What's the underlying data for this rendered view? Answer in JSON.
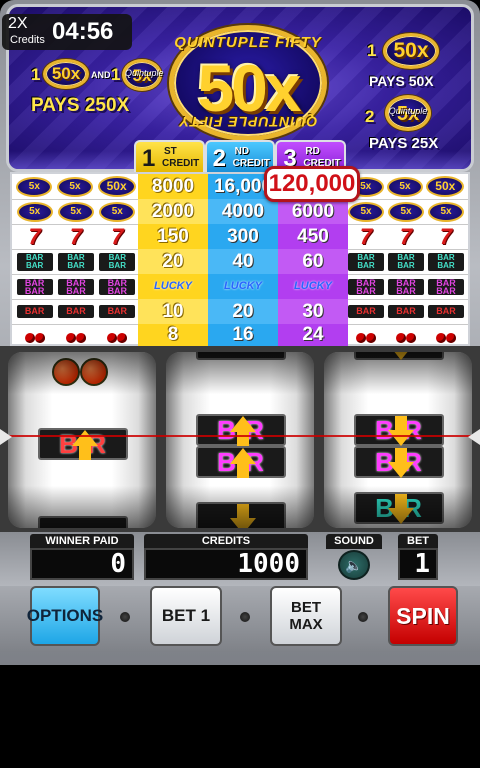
{
  "status": {
    "multiplier": "2X",
    "credits_label": "Credits",
    "time": "04:56"
  },
  "top_panel": {
    "logo_top_arc": "QUINTUPLE FIFTY",
    "logo_bottom_arc": "QUINTUPLE FIFTY",
    "logo_big": "50x",
    "left_prefix_1": "1",
    "left_badge_50x": "50x",
    "left_and": "AND",
    "left_prefix_2": "1",
    "left_badge_5x": "5x",
    "left_badge_caption": "Quintuple",
    "left_pays": "PAYS 250X",
    "right_prefix_1": "1",
    "right_badge_50x": "50x",
    "right_pays_1": "PAYS 50X",
    "right_prefix_2": "2",
    "right_badge_5x": "5x",
    "right_badge_caption": "Quintuple",
    "right_pays_2": "PAYS 25X"
  },
  "paytable_header": [
    {
      "num": "1",
      "sup": "ST",
      "word": "CREDIT"
    },
    {
      "num": "2",
      "sup": "ND",
      "word": "CREDIT"
    },
    {
      "num": "3",
      "sup": "RD",
      "word": "CREDIT"
    }
  ],
  "jackpot": "120,000",
  "paytable": [
    {
      "symbol": "50x-mix",
      "c1": "8000",
      "c2": "16,000",
      "c3": ""
    },
    {
      "symbol": "5x",
      "c1": "2000",
      "c2": "4000",
      "c3": "6000"
    },
    {
      "symbol": "seven",
      "c1": "150",
      "c2": "300",
      "c3": "450"
    },
    {
      "symbol": "triple-bar",
      "c1": "20",
      "c2": "40",
      "c3": "60"
    },
    {
      "symbol": "lucky-wheel",
      "c1": "LUCKY WHEEL",
      "c2": "LUCKY WHEEL",
      "c3": "LUCKY WHEEL"
    },
    {
      "symbol": "single-bar",
      "c1": "10",
      "c2": "20",
      "c3": "30"
    },
    {
      "symbol": "cherry",
      "c1": "8",
      "c2": "16",
      "c3": "24"
    }
  ],
  "symbol_text": {
    "small_50x": "50x",
    "small_5x": "5x",
    "seven": "7",
    "bar": "BAR",
    "bar_short": "B  R"
  },
  "reels": [
    {
      "main_bar": "B  R"
    },
    {
      "main_bar_1": "B  R",
      "main_bar_2": "B  R"
    },
    {
      "main_bar_1": "B  R",
      "main_bar_2": "B  R",
      "lower_bar": "B  R"
    }
  ],
  "displays": {
    "winner_paid_label": "WINNER PAID",
    "winner_paid": "0",
    "credits_label": "CREDITS",
    "credits": "1000",
    "sound_label": "SOUND",
    "bet_label": "BET",
    "bet": "1"
  },
  "buttons": {
    "options": "OPTIONS",
    "bet1": "BET 1",
    "betmax_1": "BET",
    "betmax_2": "MAX",
    "spin": "SPIN"
  }
}
